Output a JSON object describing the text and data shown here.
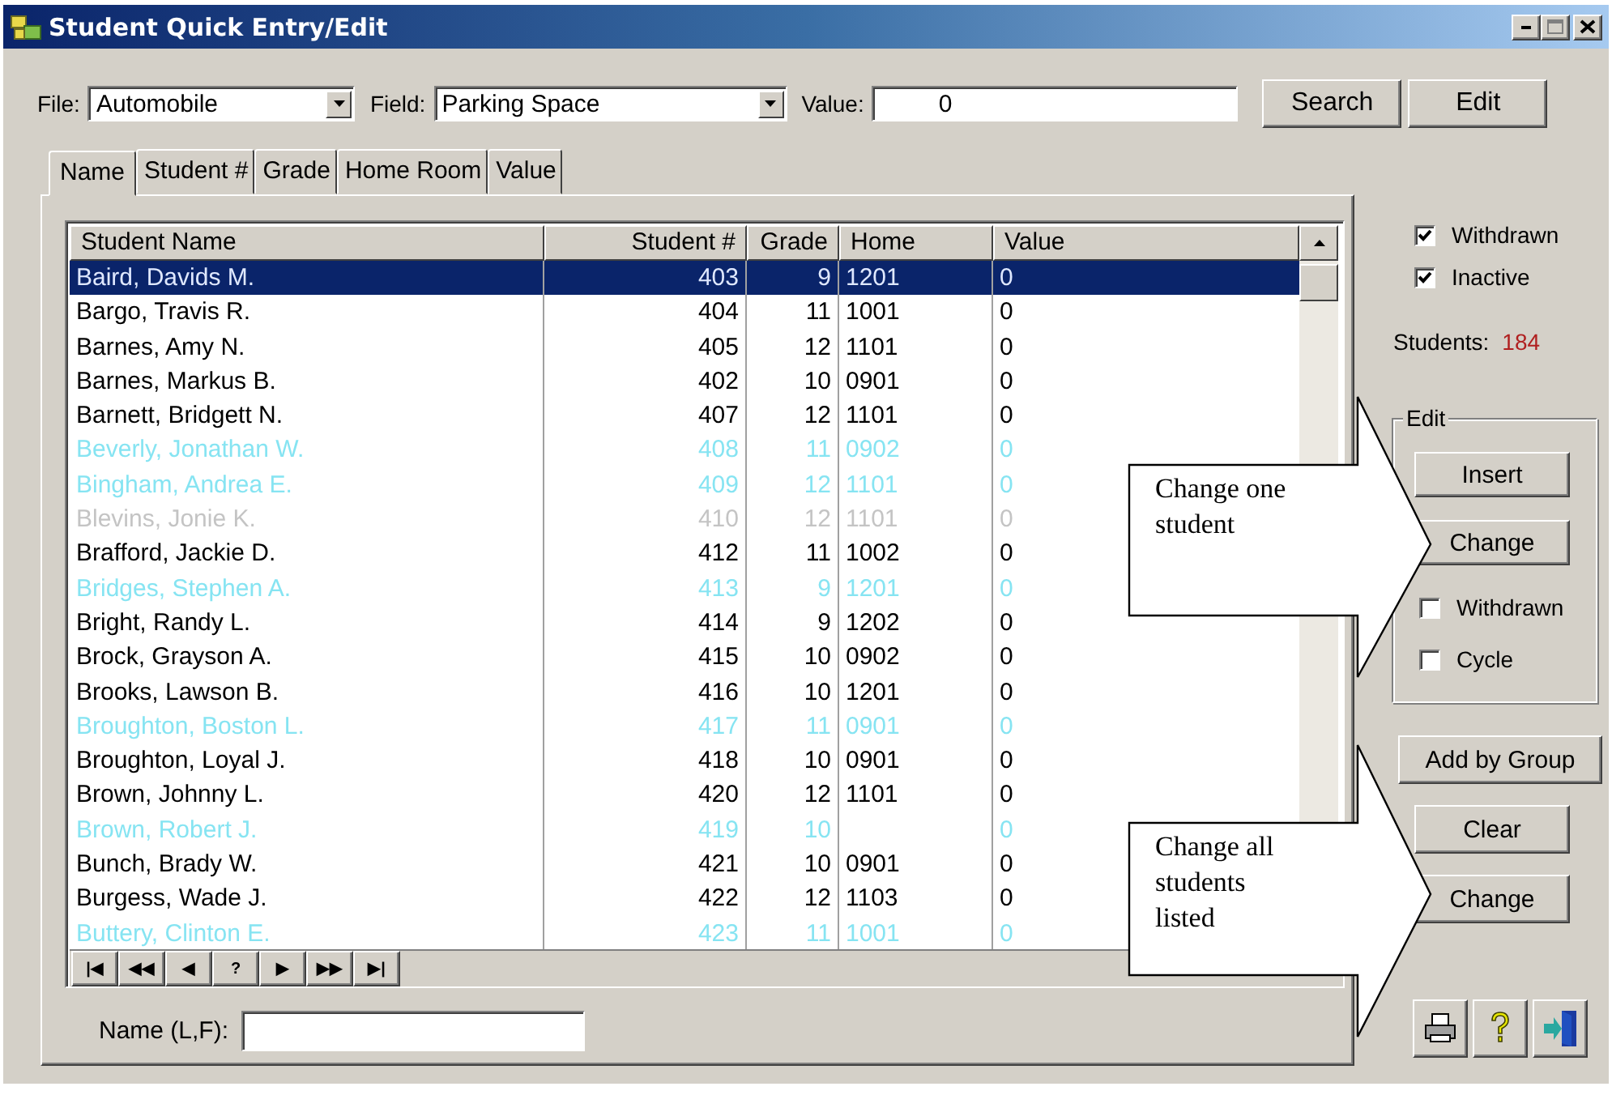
{
  "window": {
    "title": "Student Quick Entry/Edit"
  },
  "filters": [
    {
      "label": "File:",
      "kind": "combo",
      "value": "Automobile"
    },
    {
      "label": "Field:",
      "kind": "combo",
      "value": "Parking Space"
    },
    {
      "label": "Value:",
      "kind": "text",
      "value": "0"
    }
  ],
  "actions": [
    "Search",
    "Edit"
  ],
  "tabs": [
    {
      "label": "Name",
      "selected": true
    },
    {
      "label": "Student #",
      "selected": false
    },
    {
      "label": "Grade",
      "selected": false
    },
    {
      "label": "Home Room",
      "selected": false
    },
    {
      "label": "Value",
      "selected": false
    }
  ],
  "grid": {
    "columns": [
      "Student Name",
      "Student #",
      "Grade",
      "Home",
      "Value"
    ],
    "rows": [
      {
        "name": "Baird, Davids M.",
        "number": "403",
        "grade": "9",
        "home": "1201",
        "value": "0",
        "withdrawn": false,
        "inactive": false,
        "selected": true
      },
      {
        "name": "Bargo, Travis R.",
        "number": "404",
        "grade": "11",
        "home": "1001",
        "value": "0",
        "withdrawn": false,
        "inactive": false,
        "selected": false
      },
      {
        "name": "Barnes, Amy N.",
        "number": "405",
        "grade": "12",
        "home": "1101",
        "value": "0",
        "withdrawn": false,
        "inactive": false,
        "selected": false
      },
      {
        "name": "Barnes, Markus B.",
        "number": "402",
        "grade": "10",
        "home": "0901",
        "value": "0",
        "withdrawn": false,
        "inactive": false,
        "selected": false
      },
      {
        "name": "Barnett, Bridgett N.",
        "number": "407",
        "grade": "12",
        "home": "1101",
        "value": "0",
        "withdrawn": false,
        "inactive": false,
        "selected": false
      },
      {
        "name": "Beverly, Jonathan W.",
        "number": "408",
        "grade": "11",
        "home": "0902",
        "value": "0",
        "withdrawn": true,
        "inactive": false,
        "selected": false
      },
      {
        "name": "Bingham, Andrea E.",
        "number": "409",
        "grade": "12",
        "home": "1101",
        "value": "0",
        "withdrawn": true,
        "inactive": false,
        "selected": false
      },
      {
        "name": "Blevins, Jonie K.",
        "number": "410",
        "grade": "12",
        "home": "1101",
        "value": "0",
        "withdrawn": false,
        "inactive": true,
        "selected": false
      },
      {
        "name": "Brafford, Jackie D.",
        "number": "412",
        "grade": "11",
        "home": "1002",
        "value": "0",
        "withdrawn": false,
        "inactive": false,
        "selected": false
      },
      {
        "name": "Bridges, Stephen A.",
        "number": "413",
        "grade": "9",
        "home": "1201",
        "value": "0",
        "withdrawn": true,
        "inactive": false,
        "selected": false
      },
      {
        "name": "Bright, Randy L.",
        "number": "414",
        "grade": "9",
        "home": "1202",
        "value": "0",
        "withdrawn": false,
        "inactive": false,
        "selected": false
      },
      {
        "name": "Brock, Grayson A.",
        "number": "415",
        "grade": "10",
        "home": "0902",
        "value": "0",
        "withdrawn": false,
        "inactive": false,
        "selected": false
      },
      {
        "name": "Brooks, Lawson B.",
        "number": "416",
        "grade": "10",
        "home": "1201",
        "value": "0",
        "withdrawn": false,
        "inactive": false,
        "selected": false
      },
      {
        "name": "Broughton, Boston L.",
        "number": "417",
        "grade": "11",
        "home": "0901",
        "value": "0",
        "withdrawn": true,
        "inactive": false,
        "selected": false
      },
      {
        "name": "Broughton, Loyal J.",
        "number": "418",
        "grade": "10",
        "home": "0901",
        "value": "0",
        "withdrawn": false,
        "inactive": false,
        "selected": false
      },
      {
        "name": "Brown, Johnny L.",
        "number": "420",
        "grade": "12",
        "home": "1101",
        "value": "0",
        "withdrawn": false,
        "inactive": false,
        "selected": false
      },
      {
        "name": "Brown, Robert J.",
        "number": "419",
        "grade": "10",
        "value": "0",
        "withdrawn": true,
        "inactive": false,
        "selected": false
      },
      {
        "name": "Bunch, Brady W.",
        "number": "421",
        "grade": "10",
        "home": "0901",
        "value": "0",
        "withdrawn": false,
        "inactive": false,
        "selected": false
      },
      {
        "name": "Burgess, Wade J.",
        "number": "422",
        "grade": "12",
        "home": "1103",
        "value": "0",
        "withdrawn": false,
        "inactive": false,
        "selected": false
      },
      {
        "name": "Buttery, Clinton E.",
        "number": "423",
        "grade": "11",
        "home": "1001",
        "value": "0",
        "withdrawn": true,
        "inactive": false,
        "selected": false
      }
    ]
  },
  "navigator": [
    "|◀",
    "◀◀",
    "◀",
    "?",
    "▶",
    "▶▶",
    "▶|"
  ],
  "name_filter": {
    "label": "Name (L,F):"
  },
  "options": [
    {
      "label": "Withdrawn",
      "checked": true
    },
    {
      "label": "Inactive",
      "checked": true
    }
  ],
  "student_count": {
    "label": "Students:",
    "value": "184"
  },
  "edit_group": {
    "title": "Edit",
    "buttons": [
      "Insert",
      "Change"
    ],
    "options": [
      {
        "label": "Withdrawn",
        "checked": false
      },
      {
        "label": "Cycle",
        "checked": false
      }
    ]
  },
  "group_buttons": [
    "Add by Group",
    "Clear",
    "Change"
  ],
  "callouts": [
    {
      "text": "Change one student"
    },
    {
      "text": "Change all students listed"
    }
  ]
}
